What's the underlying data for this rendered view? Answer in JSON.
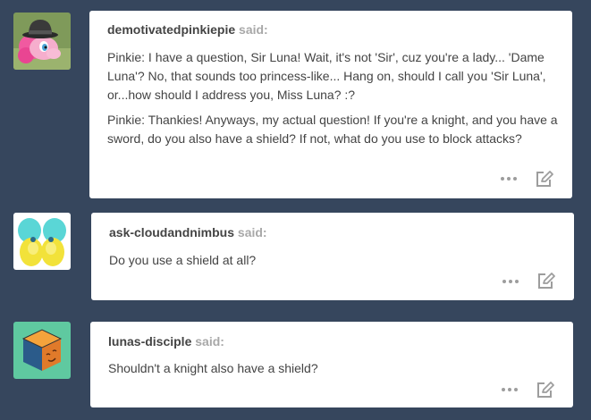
{
  "said_label": "said:",
  "messages": [
    {
      "username": "demotivatedpinkiepie",
      "avatar_icon": "pink-pony-with-bowler-hat-avatar",
      "paragraphs": [
        "Pinkie: I have a question, Sir Luna! Wait, it's not 'Sir', cuz you're a lady... 'Dame Luna'? No, that sounds too princess-like... Hang on, should I call you 'Sir Luna', or...how should I address you, Miss Luna? :?",
        "Pinkie: Thankies! Anyways, my actual question! If you're a knight, and you have a sword, do you also have a shield? If not, what do you use to block attacks?"
      ]
    },
    {
      "username": "ask-cloudandnimbus",
      "avatar_icon": "twin-yellow-ponies-avatar",
      "paragraphs": [
        "Do you use a shield at all?"
      ]
    },
    {
      "username": "lunas-disciple",
      "avatar_icon": "orange-cube-face-avatar",
      "paragraphs": [
        "Shouldn't a knight also have a shield?"
      ]
    }
  ],
  "colors": {
    "background": "#36465d",
    "card": "#ffffff",
    "text": "#444444",
    "said": "#a8a8a8",
    "icon": "#9d9d9d"
  }
}
